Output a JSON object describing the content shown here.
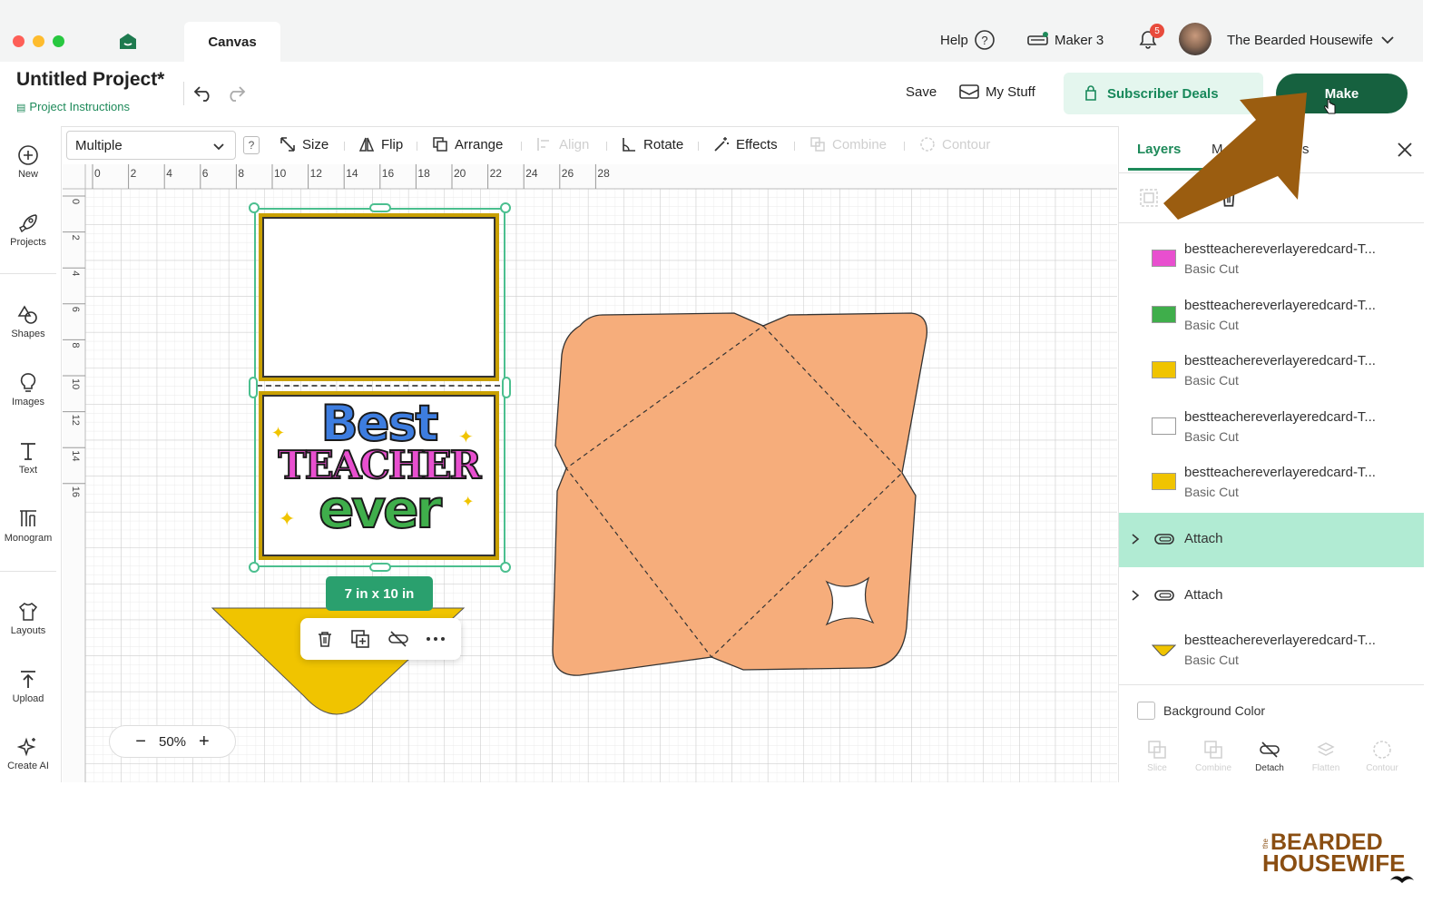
{
  "window": {
    "tab_label": "Canvas",
    "help_label": "Help",
    "machine_label": "Maker 3",
    "notification_count": "5",
    "user_name": "The Bearded Housewife"
  },
  "project": {
    "title": "Untitled Project*",
    "instructions_label": "Project Instructions"
  },
  "header": {
    "save_label": "Save",
    "my_stuff_label": "My Stuff",
    "subscriber_deals_label": "Subscriber Deals",
    "make_label": "Make"
  },
  "toolbar": {
    "operation_value": "Multiple",
    "help_glyph": "?",
    "size_label": "Size",
    "flip_label": "Flip",
    "arrange_label": "Arrange",
    "align_label": "Align",
    "rotate_label": "Rotate",
    "effects_label": "Effects",
    "combine_label": "Combine",
    "contour_label": "Contour"
  },
  "sidebar": {
    "items": [
      {
        "label": "New",
        "icon": "plus-circle-icon"
      },
      {
        "label": "Projects",
        "icon": "rocket-icon"
      },
      {
        "label": "Shapes",
        "icon": "shapes-icon"
      },
      {
        "label": "Images",
        "icon": "lightbulb-icon"
      },
      {
        "label": "Text",
        "icon": "text-icon"
      },
      {
        "label": "Monogram",
        "icon": "monogram-icon"
      },
      {
        "label": "Layouts",
        "icon": "shirt-icon"
      },
      {
        "label": "Upload",
        "icon": "upload-icon"
      },
      {
        "label": "Create AI",
        "icon": "sparkle-icon"
      }
    ]
  },
  "ruler": {
    "top": [
      "0",
      "2",
      "4",
      "6",
      "8",
      "10",
      "12",
      "14",
      "16",
      "18",
      "20",
      "22",
      "24",
      "26",
      "28"
    ],
    "left": [
      "0",
      "2",
      "4",
      "6",
      "8",
      "10",
      "12",
      "14",
      "16"
    ]
  },
  "canvas": {
    "selection_size": "7 in x 10 in",
    "card_text": [
      "Best",
      "TEACHER",
      "ever"
    ],
    "zoom_label": "50%",
    "colors": {
      "envelope": "#f6ad7b",
      "yellow": "#f0c400",
      "selection": "#4bbf8f",
      "card_gold": "#c9a000"
    }
  },
  "layers_panel": {
    "tabs": [
      "Layers",
      "M",
      "s"
    ],
    "layers": [
      {
        "name": "bestteachereverlayeredcard-T...",
        "operation": "Basic Cut",
        "color": "#e84fcf"
      },
      {
        "name": "bestteachereverlayeredcard-T...",
        "operation": "Basic Cut",
        "color": "#3fae4b"
      },
      {
        "name": "bestteachereverlayeredcard-T...",
        "operation": "Basic Cut",
        "color": "#f0c400"
      },
      {
        "name": "bestteachereverlayeredcard-T...",
        "operation": "Basic Cut",
        "color": "#ffffff"
      },
      {
        "name": "bestteachereverlayeredcard-T...",
        "operation": "Basic Cut",
        "color": "#f0c400"
      }
    ],
    "groups": [
      {
        "label": "Attach",
        "selected": true
      },
      {
        "label": "Attach",
        "selected": false
      }
    ],
    "last_layer": {
      "name": "bestteachereverlayeredcard-T...",
      "operation": "Basic Cut",
      "color": "#f0c400"
    },
    "background_color_label": "Background Color",
    "bottom_actions": [
      "Slice",
      "Combine",
      "Detach",
      "Flatten",
      "Contour"
    ]
  },
  "watermark": {
    "small": "the",
    "line1": "BEARDED",
    "line2": "HOUSEWIFE"
  }
}
